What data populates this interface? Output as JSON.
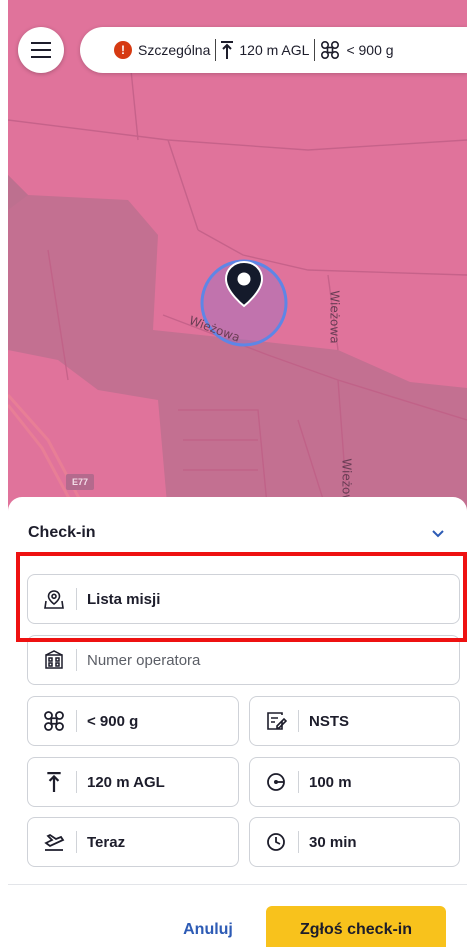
{
  "status_bar": {
    "category": "Szczególna",
    "altitude": "120 m AGL",
    "weight": "< 900 g"
  },
  "map": {
    "street_label_1": "Wieżowa",
    "street_label_2": "Wieżowa",
    "street_label_3": "Wieżowa",
    "road_badge": "E77",
    "zone_color": "#e0739b"
  },
  "sheet": {
    "title": "Check-in",
    "mission_list": "Lista misji",
    "operator_placeholder": "Numer operatora",
    "weight": "< 900 g",
    "nsts": "NSTS",
    "altitude": "120 m AGL",
    "radius": "100 m",
    "start": "Teraz",
    "duration": "30 min"
  },
  "actions": {
    "cancel": "Anuluj",
    "submit": "Zgłoś check-in",
    "submit_color": "#f8c21c"
  }
}
